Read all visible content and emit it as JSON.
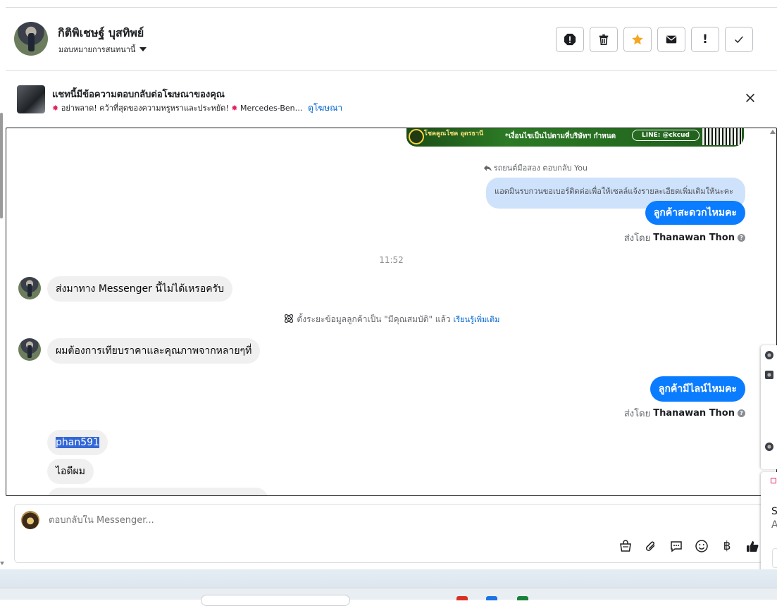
{
  "header": {
    "contact_name": "กิติพิเชษฐ์ บุสทิพย์",
    "assign_label": "มอบหมายการสนทนานี้",
    "actions": [
      {
        "name": "spam-icon",
        "label": ""
      },
      {
        "name": "trash-icon",
        "label": ""
      },
      {
        "name": "star-icon",
        "label": ""
      },
      {
        "name": "mail-icon",
        "label": ""
      },
      {
        "name": "follow-up-icon",
        "label": "!"
      },
      {
        "name": "check-icon",
        "label": ""
      }
    ]
  },
  "ad_banner": {
    "title": "แชทนี้มีข้อความตอบกลับต่อโฆษณาของคุณ",
    "subtitle": "อย่าพลาด! คว้าที่สุดของความหรูหราและประหยัด!",
    "subtitle_tail": "Mercedes-Ben…",
    "link": "ดูโฆษณา",
    "spark": "✸"
  },
  "ad_image": {
    "brand": "โชคคูณโชค อุดรธานี",
    "terms": "*เงื่อนไขเป็นไปตามที่บริษัทฯ กำหนด",
    "line": "LINE: @ckcud"
  },
  "messages": {
    "reply_context": "รถยนต์มือสอง ตอบกลับ You",
    "quoted_text": "แอดมินรบกวนขอเบอร์ติดต่อเพื่อให้เซลล์แจ้งรายละเอียดเพิ่มเติมให้นะคะ",
    "out_1": "ลูกค้าสะดวกไหมคะ",
    "sent_by_prefix": "ส่งโดย",
    "sent_by_name": "Thanawan Thon",
    "time": "11:52",
    "in_1": "ส่งมาทาง Messenger นี้ไม่ได้เหรอครับ",
    "system_text": "ตั้งระยะข้อมูลลูกค้าเป็น \"มีคุณสมบัติ\" แล้ว",
    "system_link": "เรียนรู้เพิ่มเติม",
    "in_2": "ผมต้องการเทียบราคาและคุณภาพจากหลายๆที่",
    "out_2": "ลูกค้ามีไลน์ไหมคะ",
    "sent_by_prefix_2": "ส่งโดย",
    "sent_by_name_2": "Thanawan Thon",
    "in_3": "phan591",
    "in_4": "ไอดีผม"
  },
  "composer": {
    "placeholder": "ตอบกลับใน Messenger...",
    "tools": [
      "shop-bag-icon",
      "attach-icon",
      "saved-replies-icon",
      "emoji-icon",
      "baht-icon",
      "like-icon"
    ],
    "baht_symbol": "฿"
  },
  "side_panel": {
    "letter_1": "S",
    "letter_2": "A"
  }
}
